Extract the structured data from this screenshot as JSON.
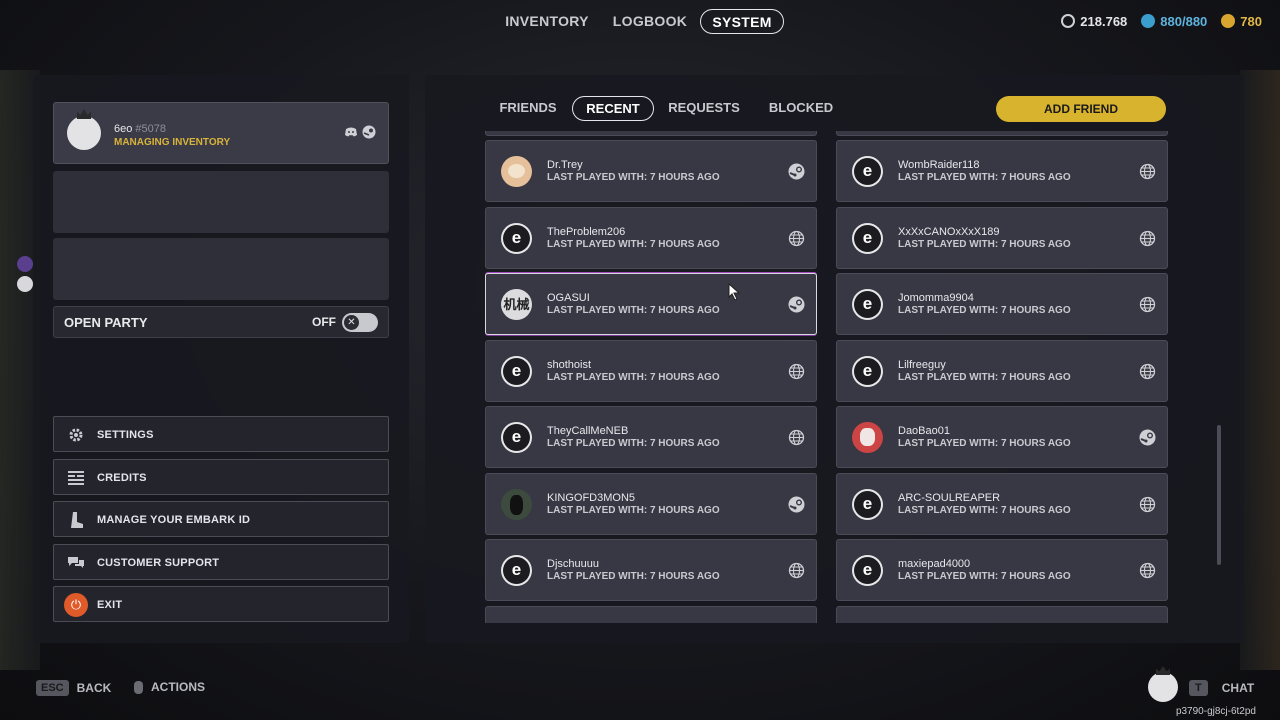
{
  "topnav": {
    "tabs": [
      {
        "label": "INVENTORY",
        "active": false
      },
      {
        "label": "LOGBOOK",
        "active": false
      },
      {
        "label": "SYSTEM",
        "active": true
      }
    ],
    "currencies": {
      "coins": "218.768",
      "blue": "880/880",
      "gold": "780"
    }
  },
  "profile": {
    "name": "6eo",
    "tag": "#5078",
    "status": "MANAGING INVENTORY",
    "icons": [
      "discord-icon",
      "steam-icon"
    ]
  },
  "party": {
    "label": "OPEN PARTY",
    "state": "OFF"
  },
  "menu": [
    {
      "label": "SETTINGS",
      "icon": "gear-icon"
    },
    {
      "label": "CREDITS",
      "icon": "credits-icon"
    },
    {
      "label": "MANAGE YOUR EMBARK ID",
      "icon": "boot-icon"
    },
    {
      "label": "CUSTOMER SUPPORT",
      "icon": "chat-bubbles-icon"
    },
    {
      "label": "EXIT",
      "icon": "power-icon"
    }
  ],
  "friends_tabs": [
    {
      "label": "FRIENDS",
      "active": false
    },
    {
      "label": "RECENT",
      "active": true
    },
    {
      "label": "REQUESTS",
      "active": false
    },
    {
      "label": "BLOCKED",
      "active": false
    }
  ],
  "add_friend_label": "ADD FRIEND",
  "recent": [
    {
      "name": "Dr.Trey",
      "status": "LAST PLAYED WITH: 7 HOURS AGO",
      "avatar": "cat",
      "platform": "steam"
    },
    {
      "name": "WombRaider118",
      "status": "LAST PLAYED WITH: 7 HOURS AGO",
      "avatar": "embark",
      "platform": "globe"
    },
    {
      "name": "TheProblem206",
      "status": "LAST PLAYED WITH: 7 HOURS AGO",
      "avatar": "embark",
      "platform": "globe"
    },
    {
      "name": "XxXxCANOxXxX189",
      "status": "LAST PLAYED WITH: 7 HOURS AGO",
      "avatar": "embark",
      "platform": "globe"
    },
    {
      "name": "OGASUI",
      "status": "LAST PLAYED WITH: 7 HOURS AGO",
      "avatar": "kanji",
      "avatar_text": "机械",
      "platform": "steam"
    },
    {
      "name": "Jomomma9904",
      "status": "LAST PLAYED WITH: 7 HOURS AGO",
      "avatar": "embark",
      "platform": "globe"
    },
    {
      "name": "shothoist",
      "status": "LAST PLAYED WITH: 7 HOURS AGO",
      "avatar": "embark",
      "platform": "globe"
    },
    {
      "name": "Lilfreeguy",
      "status": "LAST PLAYED WITH: 7 HOURS AGO",
      "avatar": "embark",
      "platform": "globe"
    },
    {
      "name": "TheyCallMeNEB",
      "status": "LAST PLAYED WITH: 7 HOURS AGO",
      "avatar": "embark",
      "platform": "globe"
    },
    {
      "name": "DaoBao01",
      "status": "LAST PLAYED WITH: 7 HOURS AGO",
      "avatar": "red",
      "platform": "steam"
    },
    {
      "name": "KINGOFD3MON5",
      "status": "LAST PLAYED WITH: 7 HOURS AGO",
      "avatar": "dark",
      "platform": "steam"
    },
    {
      "name": "ARC-SOULREAPER",
      "status": "LAST PLAYED WITH: 7 HOURS AGO",
      "avatar": "embark",
      "platform": "globe"
    },
    {
      "name": "Djschuuuu",
      "status": "LAST PLAYED WITH: 7 HOURS AGO",
      "avatar": "embark",
      "platform": "globe"
    },
    {
      "name": "maxiepad4000",
      "status": "LAST PLAYED WITH: 7 HOURS AGO",
      "avatar": "embark",
      "platform": "globe"
    }
  ],
  "bottom": {
    "back_key": "ESC",
    "back_label": "BACK",
    "actions_label": "ACTIONS",
    "chat_key": "T",
    "chat_label": "CHAT",
    "code": "p3790-gj8cj-6t2pd"
  },
  "colors": {
    "accent_gold": "#d8b32e",
    "status_gold": "#d9b33c",
    "exit_orange": "#e05a2a"
  }
}
